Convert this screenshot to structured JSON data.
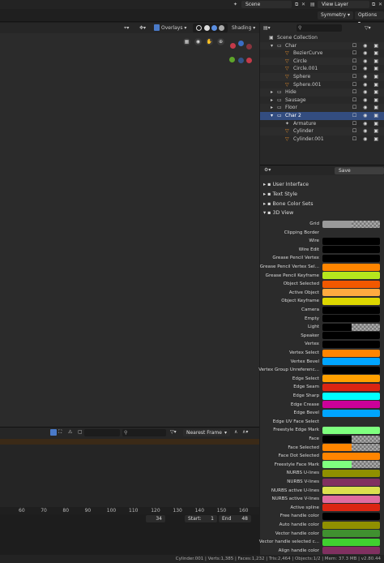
{
  "topbar": {
    "scene": "Scene",
    "view_layer": "View Layer",
    "symmetry": "Symmetry",
    "options": "Options"
  },
  "viewport": {
    "overlays": "Overlays",
    "shading": "Shading"
  },
  "outliner": {
    "rows": [
      {
        "label": "Scene Collection",
        "indent": 0,
        "style": "normal",
        "icon": "scene"
      },
      {
        "label": "Char",
        "indent": 1,
        "style": "alt",
        "icon": "collection"
      },
      {
        "label": "BezierCurve",
        "indent": 2,
        "style": "normal",
        "icon": "cone"
      },
      {
        "label": "Circle",
        "indent": 2,
        "style": "alt",
        "icon": "cone"
      },
      {
        "label": "Circle.001",
        "indent": 2,
        "style": "normal",
        "icon": "cone"
      },
      {
        "label": "Sphere",
        "indent": 2,
        "style": "alt",
        "icon": "cone"
      },
      {
        "label": "Sphere.001",
        "indent": 2,
        "style": "normal",
        "icon": "cone"
      },
      {
        "label": "Hide",
        "indent": 1,
        "style": "alt",
        "icon": "collection"
      },
      {
        "label": "Sausage",
        "indent": 1,
        "style": "normal",
        "icon": "collection"
      },
      {
        "label": "Floor",
        "indent": 1,
        "style": "alt",
        "icon": "collection"
      },
      {
        "label": "Char 2",
        "indent": 1,
        "style": "sel",
        "icon": "collection"
      },
      {
        "label": "Armature",
        "indent": 2,
        "style": "normal",
        "icon": "armature"
      },
      {
        "label": "Cylinder",
        "indent": 2,
        "style": "alt",
        "icon": "cone"
      },
      {
        "label": "Cylinder.001",
        "indent": 2,
        "style": "normal",
        "icon": "cone"
      }
    ]
  },
  "prefs": {
    "save_label": "Save Preferences",
    "sections": [
      {
        "label": "User Interface",
        "expanded": false
      },
      {
        "label": "Text Style",
        "expanded": false
      },
      {
        "label": "Bone Color Sets",
        "expanded": false
      },
      {
        "label": "3D View",
        "expanded": true
      }
    ],
    "colors": [
      {
        "label": "Grid",
        "color": "#9a9a9a",
        "alpha": 0.5
      },
      {
        "label": "Clipping Border",
        "color": "#2b2b2b",
        "alpha": 0
      },
      {
        "label": "Wire",
        "color": "#000000",
        "alpha": 0
      },
      {
        "label": "Wire Edit",
        "color": "#000000",
        "alpha": 0
      },
      {
        "label": "Grease Pencil Vertex",
        "color": "#000000",
        "alpha": 0
      },
      {
        "label": "Grease Pencil Vertex Sel...",
        "color": "#ff8500",
        "alpha": 0
      },
      {
        "label": "Grease Pencil Keyframe",
        "color": "#b5e61d",
        "alpha": 0
      },
      {
        "label": "Object Selected",
        "color": "#f15800",
        "alpha": 0
      },
      {
        "label": "Active Object",
        "color": "#ffaa40",
        "alpha": 0
      },
      {
        "label": "Object Keyframe",
        "color": "#ddd700",
        "alpha": 0
      },
      {
        "label": "Camera",
        "color": "#000000",
        "alpha": 0
      },
      {
        "label": "Empty",
        "color": "#000000",
        "alpha": 0
      },
      {
        "label": "Light",
        "color": "#000000",
        "alpha": 0.5
      },
      {
        "label": "Speaker",
        "color": "#000000",
        "alpha": 0
      },
      {
        "label": "Vertex",
        "color": "#000000",
        "alpha": 0
      },
      {
        "label": "Vertex Select",
        "color": "#ff8500",
        "alpha": 0
      },
      {
        "label": "Vertex Bevel",
        "color": "#00a5ff",
        "alpha": 0
      },
      {
        "label": "Vertex Group Unreferenc...",
        "color": "#000000",
        "alpha": 0
      },
      {
        "label": "Edge Select",
        "color": "#ffa000",
        "alpha": 0
      },
      {
        "label": "Edge Seam",
        "color": "#db2512",
        "alpha": 0
      },
      {
        "label": "Edge Sharp",
        "color": "#00ffff",
        "alpha": 0
      },
      {
        "label": "Edge Crease",
        "color": "#cc0099",
        "alpha": 0
      },
      {
        "label": "Edge Bevel",
        "color": "#00a5ff",
        "alpha": 0
      },
      {
        "label": "Edge UV Face Select",
        "color": "#2b2b2b",
        "alpha": 0
      },
      {
        "label": "Freestyle Edge Mark",
        "color": "#7fff7f",
        "alpha": 0
      },
      {
        "label": "Face",
        "color": "#000000",
        "alpha": 0.5
      },
      {
        "label": "Face Selected",
        "color": "#ff8500",
        "alpha": 0.5
      },
      {
        "label": "Face Dot Selected",
        "color": "#ff8500",
        "alpha": 0
      },
      {
        "label": "Freestyle Face Mark",
        "color": "#7fff7f",
        "alpha": 0.5
      },
      {
        "label": "NURBS U-lines",
        "color": "#909000",
        "alpha": 0
      },
      {
        "label": "NURBS V-lines",
        "color": "#803060",
        "alpha": 0
      },
      {
        "label": "NURBS active U-lines",
        "color": "#dbe04f",
        "alpha": 0
      },
      {
        "label": "NURBS active V-lines",
        "color": "#e06ca0",
        "alpha": 0
      },
      {
        "label": "Active spline",
        "color": "#db2512",
        "alpha": 0
      },
      {
        "label": "Free handle color",
        "color": "#000000",
        "alpha": 0
      },
      {
        "label": "Auto handle color",
        "color": "#909000",
        "alpha": 0
      },
      {
        "label": "Vector handle color",
        "color": "#409030",
        "alpha": 0
      },
      {
        "label": "Vector handle selected c...",
        "color": "#40d030",
        "alpha": 0
      },
      {
        "label": "Align handle color",
        "color": "#803060",
        "alpha": 0
      }
    ]
  },
  "timeline": {
    "snap": "Nearest Frame",
    "ticks": [
      "60",
      "70",
      "80",
      "90",
      "100",
      "110",
      "120",
      "130",
      "140",
      "150",
      "160"
    ],
    "current_frame": "34",
    "start_label": "Start:",
    "start_value": "1",
    "end_label": "End",
    "end_value": "48"
  },
  "status": {
    "text": "Cylinder.001 | Verts:1,385 | Faces:1,232 | Tris:2,464 | Objects:1/2 | Mem: 37.3 MB | v2.80.44"
  }
}
